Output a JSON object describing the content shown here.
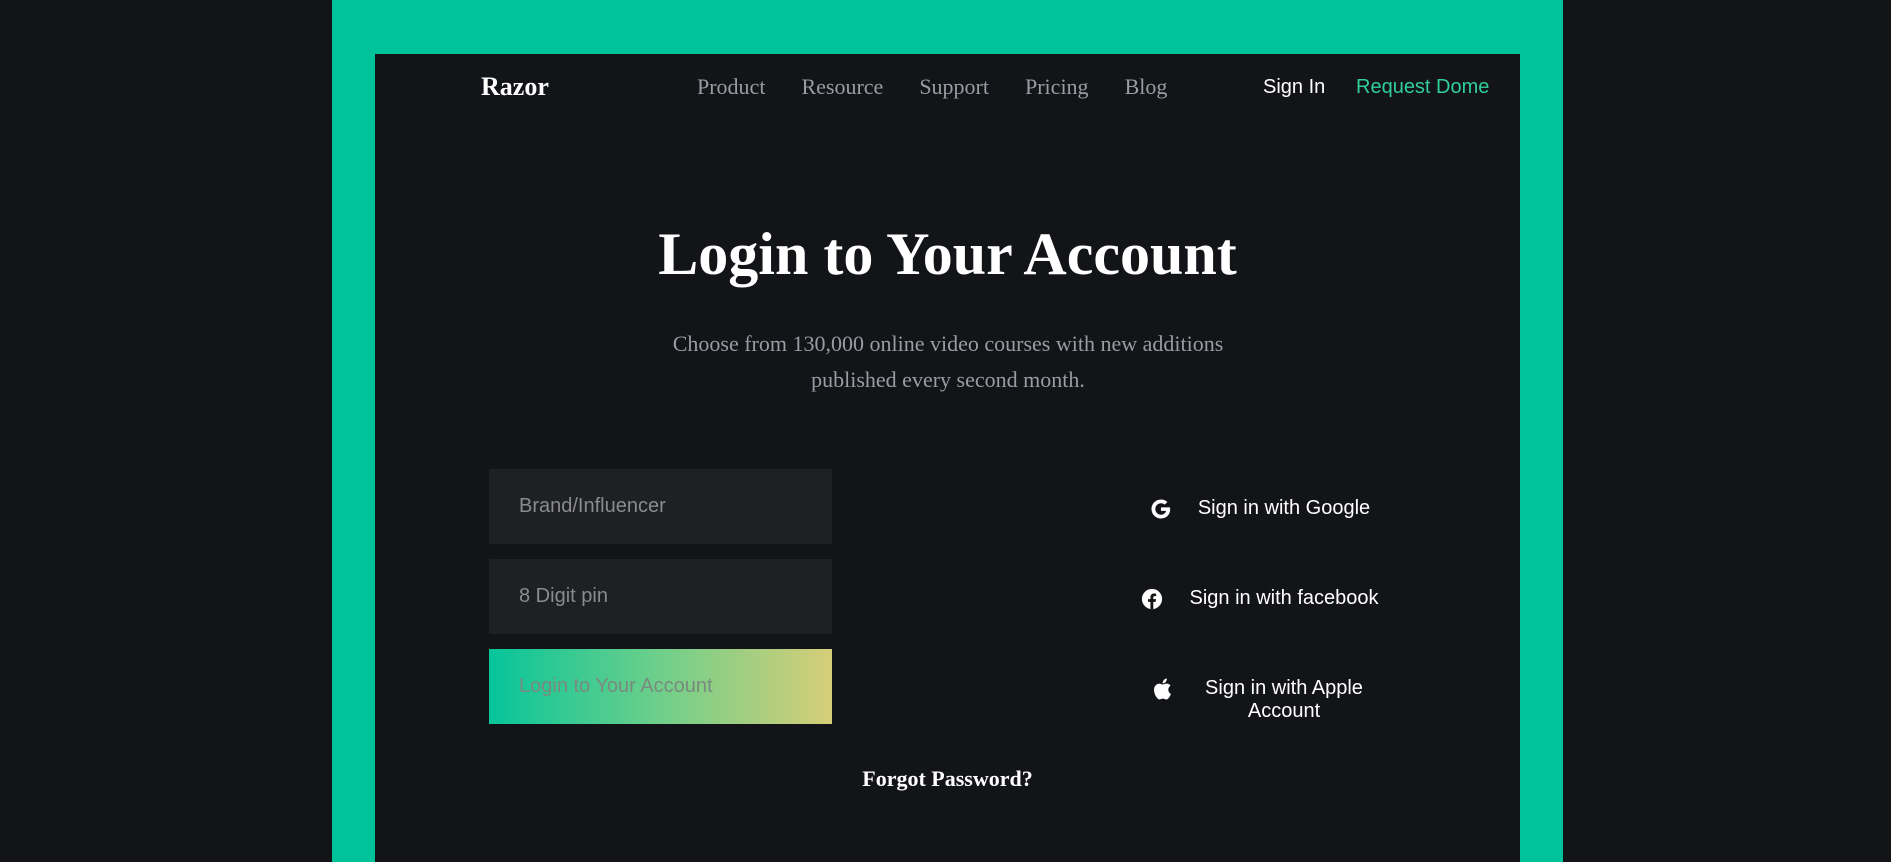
{
  "header": {
    "logo": "Razor",
    "nav": [
      "Product",
      "Resource",
      "Support",
      "Pricing",
      "Blog"
    ],
    "sign_in": "Sign In",
    "request_demo": "Request Dome"
  },
  "hero": {
    "title": "Login to Your Account",
    "subtitle": "Choose from 130,000 online video courses with new additions published every second month."
  },
  "form": {
    "brand_placeholder": "Brand/Influencer",
    "pin_placeholder": "8 Digit pin",
    "login_button": "Login to Your Account",
    "forgot_password": "Forgot Password?"
  },
  "social": {
    "google": "Sign in with Google",
    "facebook": "Sign in with facebook",
    "apple": "Sign in with Apple Account"
  },
  "colors": {
    "frame": "#00c39b",
    "background": "#131418",
    "accent": "#2fcf97",
    "input_bg": "#1f2022"
  },
  "icons": {
    "google": "google-icon",
    "facebook": "facebook-icon",
    "apple": "apple-icon"
  }
}
